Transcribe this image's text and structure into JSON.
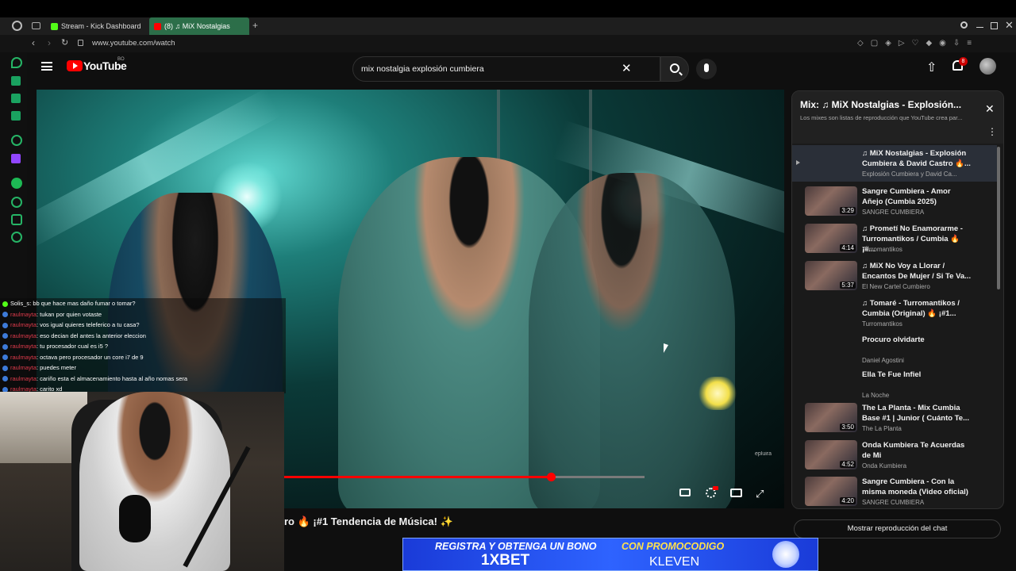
{
  "browser": {
    "tabs": [
      {
        "label": "Stream - Kick Dashboard"
      },
      {
        "label": "(8) ♫ MiX Nostalgias"
      }
    ],
    "url": "www.youtube.com/watch",
    "new_tab_label": "+"
  },
  "youtube": {
    "logo_text": "YouTube",
    "logo_suffix": "BO",
    "search_value": "mix nostalgia explosión cumbiera",
    "notif_count": "8"
  },
  "video": {
    "title": "ro 🔥 ¡#1 Tendencia de Música! ✨",
    "progress_fraction": 0.74,
    "watermark": "epluira"
  },
  "playlist": {
    "title": "Mix: ♫ MiX Nostalgias - Explosión...",
    "subtitle": "Los mixes son listas de reproducción que YouTube crea par...",
    "items": [
      {
        "title": "♫ MiX Nostalgias - Explosión Cumbiera & David Castro 🔥...",
        "channel": "Explosión Cumbiera y David Ca...",
        "duration": "",
        "active": true
      },
      {
        "title": "Sangre Cumbiera - Amor Añejo (Cumbia 2025)",
        "channel": "SANGRE CUMBIERA",
        "duration": "3:29"
      },
      {
        "title": "♫ Prometí No Enamorarme - Turromantikos / Cumbia 🔥 ¡#...",
        "channel": "Turromantikos",
        "duration": "4:14"
      },
      {
        "title": "♫ MiX No Voy a Llorar / Encantos De Mujer / Si Te Va...",
        "channel": "El New Cartel Cumbiero",
        "duration": "5:37"
      },
      {
        "title": "♫ Tomaré - Turromantikos / Cumbia (Original) 🔥 ¡#1...",
        "channel": "Turromantikos",
        "duration": ""
      },
      {
        "title": "Procuro olvidarte",
        "channel": "Daniel Agostini",
        "duration": ""
      },
      {
        "title": "Ella Te Fue Infiel",
        "channel": "La Noche",
        "duration": ""
      },
      {
        "title": "The La Planta - Mix Cumbia Base #1 | Junior ( Cuánto Te...",
        "channel": "The La Planta",
        "duration": "3:50"
      },
      {
        "title": "Onda Kumbiera Te Acuerdas de Mi",
        "channel": "Onda Kumbiera",
        "duration": "4:52"
      },
      {
        "title": "Sangre Cumbiera - Con la misma moneda (Video oficial)",
        "channel": "SANGRE CUMBIERA",
        "duration": "4:20"
      }
    ],
    "show_chat_label": "Mostrar reproducción del chat"
  },
  "chat": {
    "messages": [
      {
        "user": "Solis_s",
        "text": ": bb que hace mas daño fumar o tomar?"
      },
      {
        "user": "raulmayta",
        "text": ": tukan por quien votaste"
      },
      {
        "user": "raulmayta",
        "text": ": vos igual quieres teleferico a tu casa?"
      },
      {
        "user": "raulmayta",
        "text": ": eso decian del antes la anterior eleccion"
      },
      {
        "user": "raulmayta",
        "text": ": tu procesador cual es i5 ?"
      },
      {
        "user": "raulmayta",
        "text": ": octava pero procesador un core i7 de 9"
      },
      {
        "user": "raulmayta",
        "text": ": puedes meter"
      },
      {
        "user": "raulmayta",
        "text": ": cariño esta el almacenamiento hasta al año nomas sera"
      },
      {
        "user": "raulmayta",
        "text": ": carito xd"
      }
    ]
  },
  "banner": {
    "line1_left": "REGISTRA Y OBTENGA UN BONO",
    "line1_right": "CON PROMOCODIGO",
    "brand": "1XBET",
    "code": "KLEVEN"
  },
  "colors": {
    "accent_red": "#ff0000",
    "kick_green": "#53fc18",
    "banner_blue": "#2e63ff"
  }
}
